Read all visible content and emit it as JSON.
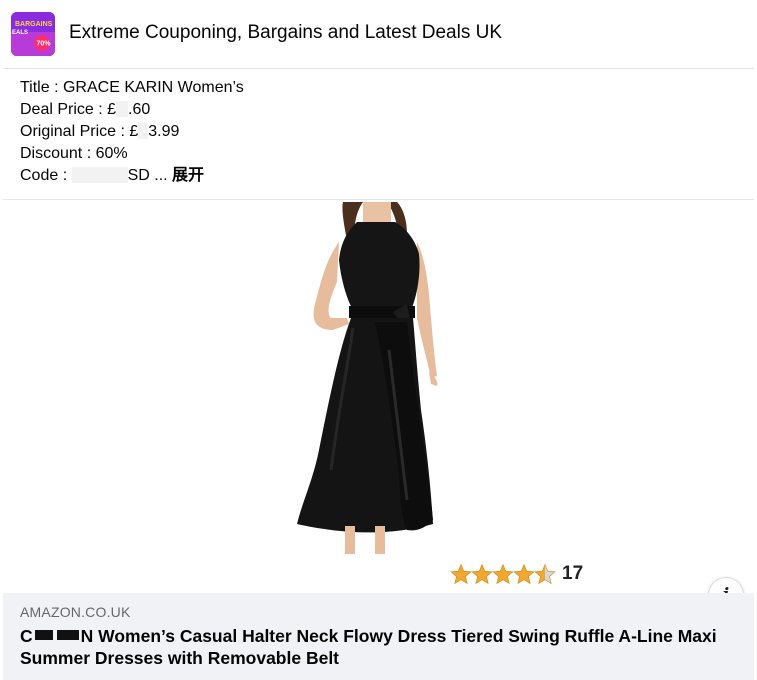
{
  "page": {
    "name": "Extreme Couponing, Bargains and Latest Deals UK",
    "logo_text": "BARGAINS",
    "logo_badge": "70%"
  },
  "post": {
    "lines": [
      "Title : GRACE KARIN Women’s",
      "Deal Price : £",
      ".60",
      "Original Price : £",
      "3.99",
      "Discount : 60%",
      "Code : ",
      "SD ... ",
      "展开"
    ]
  },
  "product": {
    "rating_stars": 4.5,
    "rating_count": "17"
  },
  "link": {
    "domain": "AMAZON.CO.UK",
    "title_prefix": "C",
    "title_rest": "N Women’s Casual Halter Neck Flowy Dress Tiered Swing Ruffle A-Line Maxi Summer Dresses with Removable Belt"
  },
  "colors": {
    "star": "#f0a830",
    "footer_bg": "#f0f2f5",
    "dress": "#141414"
  },
  "icons": {
    "info": "info-icon",
    "star": "star-icon"
  }
}
